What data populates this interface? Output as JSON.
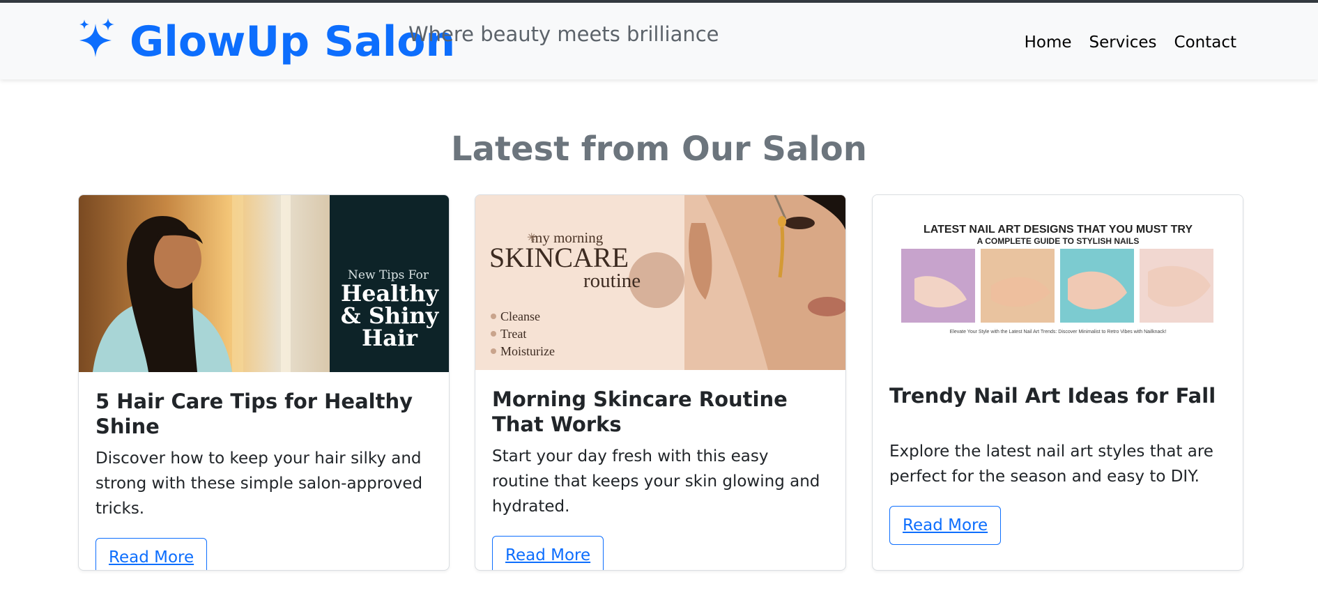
{
  "brand": {
    "name": "GlowUp Salon",
    "tagline": "Where beauty meets brilliance",
    "icon": "sparkles-icon",
    "accent_color": "#0d6efd"
  },
  "nav": {
    "items": [
      "Home",
      "Services",
      "Contact"
    ]
  },
  "section": {
    "title": "Latest from Our Salon"
  },
  "cards": [
    {
      "title": "5 Hair Care Tips for Healthy Shine",
      "text": "Discover how to keep your hair silky and strong with these simple salon-approved tricks.",
      "button": "Read More",
      "image": {
        "line1": "New Tips For",
        "line2": "Healthy",
        "line3": "& Shiny",
        "line4": "Hair"
      }
    },
    {
      "title": "Morning Skincare Routine That Works",
      "text": "Start your day fresh with this easy routine that keeps your skin glowing and hydrated.",
      "button": "Read More",
      "image": {
        "line1": "my morning",
        "line2": "SKINCARE",
        "line3": "routine",
        "steps": [
          "Cleanse",
          "Treat",
          "Moisturize"
        ]
      }
    },
    {
      "title": "Trendy Nail Art Ideas for Fall",
      "text": "Explore the latest nail art styles that are perfect for the season and easy to DIY.",
      "button": "Read More",
      "image": {
        "heading": "LATEST NAIL ART DESIGNS THAT YOU MUST TRY",
        "subheading": "A COMPLETE GUIDE TO STYLISH NAILS",
        "footer": "Elevate Your Style with the Latest Nail Art Trends: Discover Minimalist to Retro Vibes with Nailknack!"
      }
    }
  ]
}
